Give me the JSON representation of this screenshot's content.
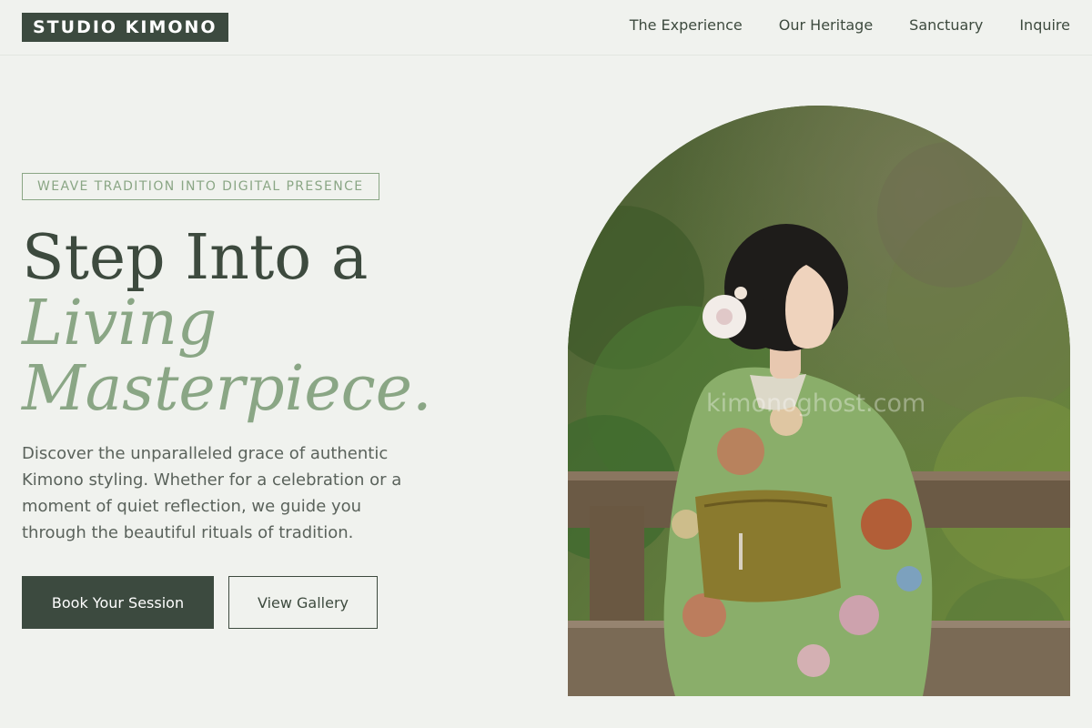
{
  "brand": {
    "logo_text": "STUDIO KIMONO"
  },
  "nav": {
    "items": [
      {
        "label": "The Experience"
      },
      {
        "label": "Our Heritage"
      },
      {
        "label": "Sanctuary"
      },
      {
        "label": "Inquire"
      }
    ]
  },
  "hero": {
    "tagline": "WEAVE TRADITION INTO DIGITAL PRESENCE",
    "headline": {
      "line1": "Step Into a",
      "line2": "Living",
      "line3": "Masterpiece."
    },
    "description": "Discover the unparalleled grace of authentic Kimono styling. Whether for a celebration or a moment of quiet reflection, we guide you through the beautiful rituals of tradition.",
    "primary_button": "Book Your Session",
    "secondary_button": "View Gallery",
    "photo_watermark": "kimonoghost.com"
  },
  "colors": {
    "background": "#f0f2ee",
    "dark_green": "#3c4a3f",
    "sage_accent": "#8aa685",
    "text": "#3d4a3e"
  }
}
